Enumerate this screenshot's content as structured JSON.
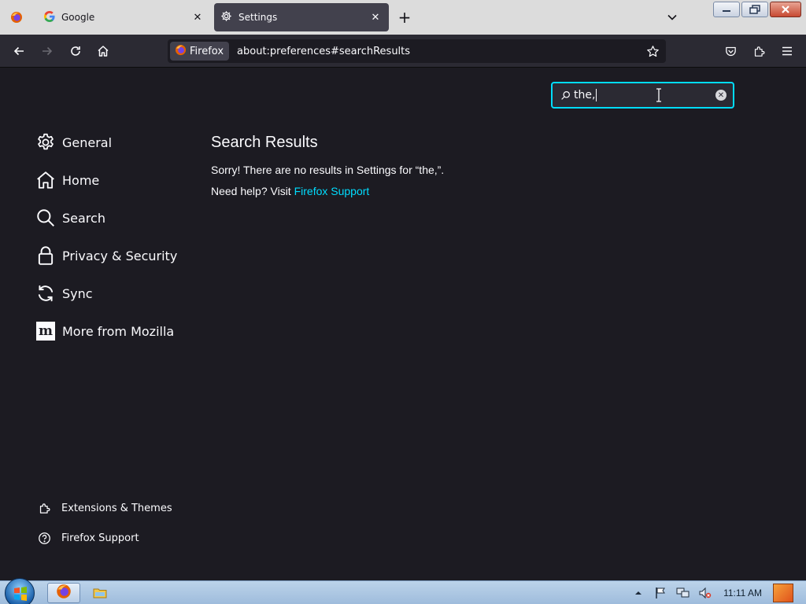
{
  "browser": {
    "tabs": [
      {
        "label": "Google",
        "icon": "google-icon",
        "active": false
      },
      {
        "label": "Settings",
        "icon": "gear-icon",
        "active": true
      }
    ],
    "urlbar": {
      "identity_label": "Firefox",
      "url": "about:preferences#searchResults"
    }
  },
  "settings": {
    "search": {
      "value": "the,"
    },
    "categories": [
      {
        "label": "General",
        "icon": "gear-icon"
      },
      {
        "label": "Home",
        "icon": "home-icon"
      },
      {
        "label": "Search",
        "icon": "search-icon"
      },
      {
        "label": "Privacy & Security",
        "icon": "lock-icon"
      },
      {
        "label": "Sync",
        "icon": "sync-icon"
      },
      {
        "label": "More from Mozilla",
        "icon": "mozilla-icon"
      }
    ],
    "footer_links": [
      {
        "label": "Extensions & Themes",
        "icon": "puzzle-icon"
      },
      {
        "label": "Firefox Support",
        "icon": "help-icon"
      }
    ],
    "results": {
      "title": "Search Results",
      "no_results": "Sorry! There are no results in Settings for “the,”.",
      "help_prefix": "Need help? Visit ",
      "help_link": "Firefox Support"
    }
  },
  "taskbar": {
    "clock": "11:11 AM"
  },
  "colors": {
    "accent": "#00ddff",
    "background": "#1c1b22",
    "toolbar": "#2b2a33",
    "tab_active": "#42414d"
  }
}
